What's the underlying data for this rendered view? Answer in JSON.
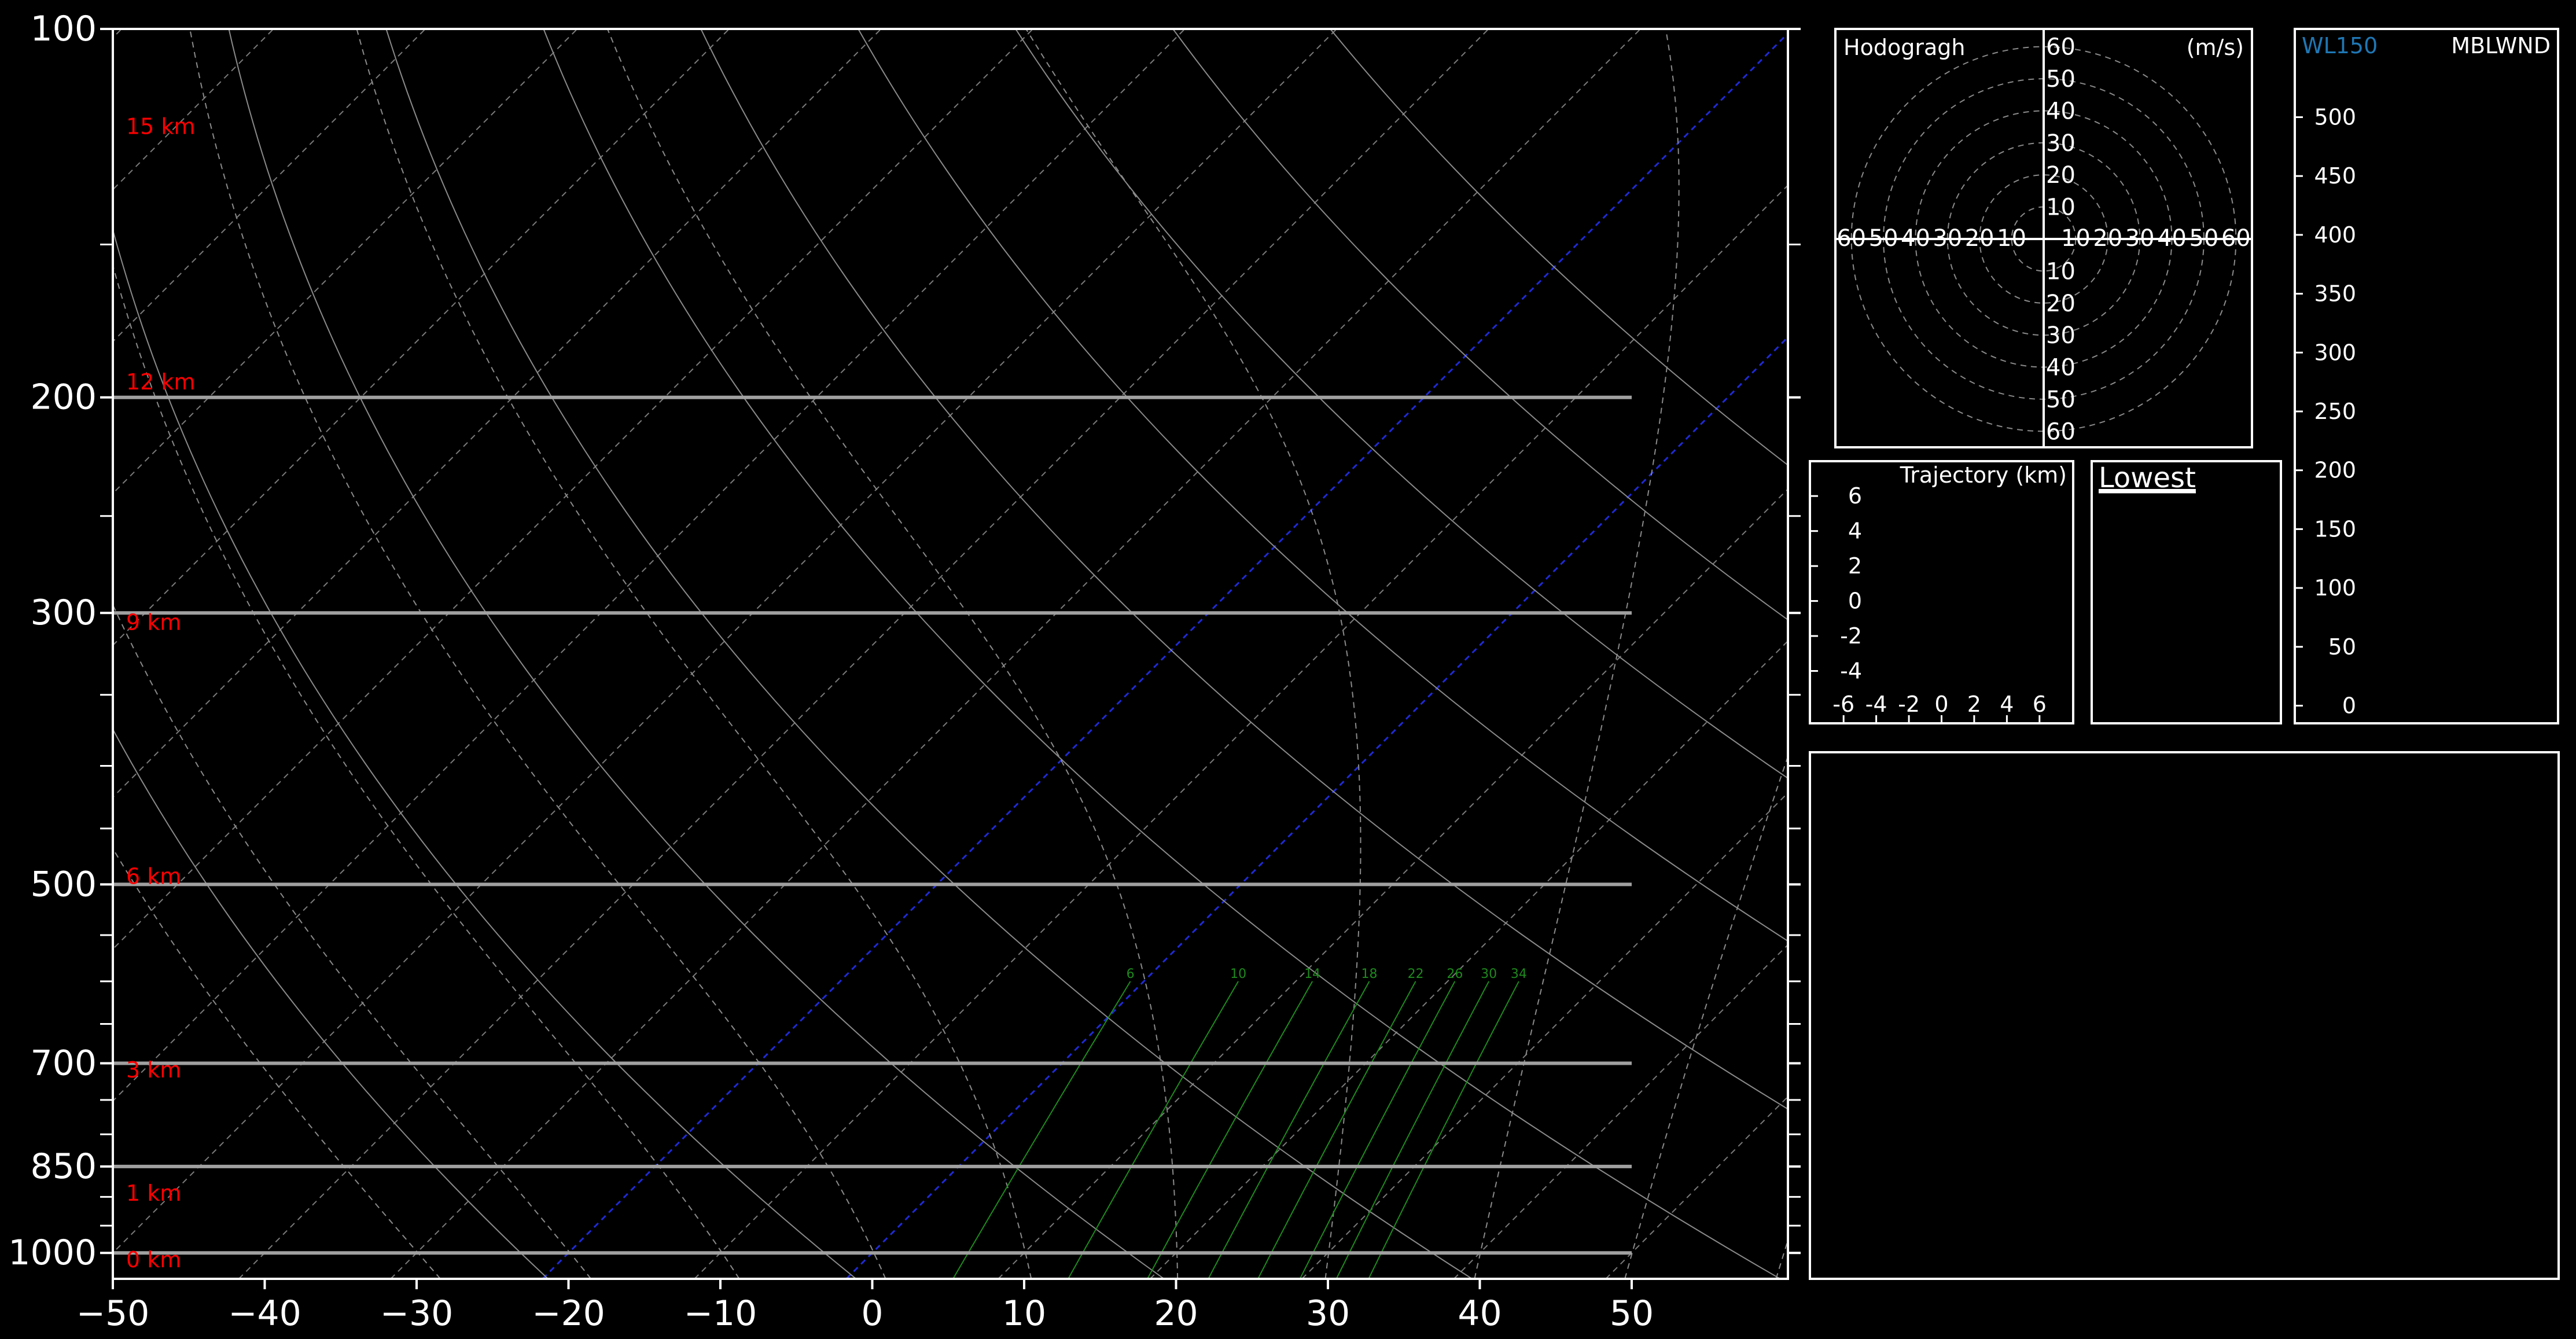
{
  "colors": {
    "background": "#000000",
    "frame": "#ffffff",
    "isobar": "#a0a0a0",
    "dry_adiabat": "#8a8a8a",
    "moist_adiabat": "#8a8a8a",
    "isotherm": "#7a7a7a",
    "freezing_isotherms": "#1f2bd6",
    "mixing_ratio": "#1e8a1e",
    "height_label": "#ff0000",
    "wind_label": "#1f77b4"
  },
  "chart_data": [
    {
      "type": "skewt",
      "xlabel": "",
      "ylabel": "",
      "temperature_ticks": [
        "−50",
        "−40",
        "−30",
        "−20",
        "−10",
        "0",
        "10",
        "20",
        "30",
        "40",
        "50"
      ],
      "temperature_values": [
        -50,
        -40,
        -30,
        -20,
        -10,
        0,
        10,
        20,
        30,
        40,
        50
      ],
      "pressure_tick_labels": [
        "100",
        "200",
        "300",
        "500",
        "700",
        "850",
        "1000"
      ],
      "pressure_ticks": [
        100,
        200,
        300,
        500,
        700,
        850,
        1000
      ],
      "minor_pressure_ticks": [
        150,
        250,
        350,
        400,
        450,
        550,
        600,
        650,
        750,
        800,
        900,
        950
      ],
      "xlim": [
        -50,
        50
      ],
      "ylim": [
        1050,
        100
      ],
      "y_scale": "log",
      "isobars": [
        200,
        300,
        500,
        700,
        850,
        1000
      ],
      "height_labels": [
        "15 km",
        "12 km",
        "9 km",
        "6 km",
        "3 km",
        "1 km",
        "0 km"
      ],
      "height_label_pressures": [
        120,
        194,
        305,
        492,
        708,
        893,
        1012
      ],
      "isotherms_every": 10,
      "highlighted_isotherms": [
        -20,
        0
      ],
      "dry_adiabats_theta_K": [
        250,
        270,
        290,
        310,
        330,
        350,
        370,
        390,
        410,
        430
      ],
      "moist_adiabats_start_C_at_1000hPa": [
        -30,
        -20,
        -10,
        0,
        10,
        20,
        30,
        40,
        50,
        60,
        70
      ],
      "mixing_ratio_gkg": [
        6,
        10,
        14,
        18,
        22,
        26,
        30,
        34
      ],
      "mixing_ratio_labels": [
        "6",
        "10",
        "14",
        "18",
        "22",
        "26",
        "30",
        "34"
      ],
      "mixing_ratio_top_hPa": 600,
      "grid": true
    },
    {
      "type": "polar",
      "title": "Hodogragh",
      "units_label": "(m/s)",
      "rings": [
        10,
        20,
        30,
        40,
        50,
        60
      ],
      "ring_labels": [
        "10",
        "20",
        "30",
        "40",
        "50",
        "60"
      ],
      "xlim": [
        -70,
        70
      ],
      "ylim": [
        -70,
        70
      ],
      "series": []
    },
    {
      "type": "scatter",
      "title": "Trajectory (km)",
      "x_tick_labels": [
        "-6",
        "-4",
        "-2",
        "0",
        "2",
        "4",
        "6"
      ],
      "y_tick_labels": [
        "6",
        "4",
        "2",
        "0",
        "-2",
        "-4"
      ],
      "x_ticks": [
        -6,
        -4,
        -2,
        0,
        2,
        4,
        6
      ],
      "y_ticks": [
        6,
        4,
        2,
        0,
        -2,
        -4
      ],
      "xlim": [
        -7,
        7
      ],
      "ylim": [
        -6,
        7
      ],
      "series": []
    },
    {
      "type": "line",
      "series_labels": [
        "WL150",
        "MBLWND"
      ],
      "y_tick_labels": [
        "500",
        "450",
        "400",
        "350",
        "300",
        "250",
        "200",
        "150",
        "100",
        "50",
        "0"
      ],
      "y_ticks": [
        500,
        450,
        400,
        350,
        300,
        250,
        200,
        150,
        100,
        50,
        0
      ],
      "ylim": [
        -15,
        575
      ],
      "series": []
    }
  ],
  "panels": {
    "lowest_label": "Lowest"
  }
}
